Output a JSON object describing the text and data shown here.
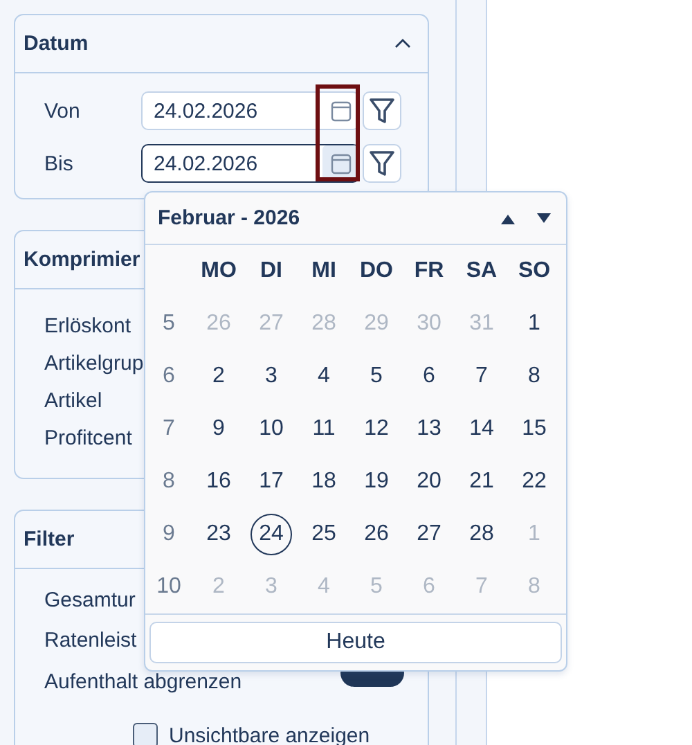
{
  "date_panel": {
    "title": "Datum",
    "expanded": true,
    "rows": [
      {
        "label": "Von",
        "value": "24.02.2026",
        "focused": false
      },
      {
        "label": "Bis",
        "value": "24.02.2026",
        "focused": true
      }
    ]
  },
  "compress_panel": {
    "title": "Komprimier",
    "items": [
      "Erlöskont",
      "Artikelgrup",
      "Artikel",
      "Profitcent"
    ]
  },
  "filter_panel": {
    "title": "Filter",
    "items": [
      {
        "kind": "text",
        "label": "Gesamtur"
      },
      {
        "kind": "toggle",
        "label": "Ratenleist",
        "label_line2": "Aufenthalt abgrenzen",
        "on": true
      }
    ],
    "checkbox": {
      "label": "Unsichtbare anzeigen",
      "checked": false
    }
  },
  "calendar": {
    "title": "Februar - 2026",
    "weekdays": [
      "MO",
      "DI",
      "MI",
      "DO",
      "FR",
      "SA",
      "SO"
    ],
    "weeks": [
      {
        "week": "5",
        "days": [
          {
            "day": "26",
            "outside": true,
            "selected": false
          },
          {
            "day": "27",
            "outside": true,
            "selected": false
          },
          {
            "day": "28",
            "outside": true,
            "selected": false
          },
          {
            "day": "29",
            "outside": true,
            "selected": false
          },
          {
            "day": "30",
            "outside": true,
            "selected": false
          },
          {
            "day": "31",
            "outside": true,
            "selected": false
          },
          {
            "day": "1",
            "outside": false,
            "selected": false
          }
        ]
      },
      {
        "week": "6",
        "days": [
          {
            "day": "2",
            "outside": false,
            "selected": false
          },
          {
            "day": "3",
            "outside": false,
            "selected": false
          },
          {
            "day": "4",
            "outside": false,
            "selected": false
          },
          {
            "day": "5",
            "outside": false,
            "selected": false
          },
          {
            "day": "6",
            "outside": false,
            "selected": false
          },
          {
            "day": "7",
            "outside": false,
            "selected": false
          },
          {
            "day": "8",
            "outside": false,
            "selected": false
          }
        ]
      },
      {
        "week": "7",
        "days": [
          {
            "day": "9",
            "outside": false,
            "selected": false
          },
          {
            "day": "10",
            "outside": false,
            "selected": false
          },
          {
            "day": "11",
            "outside": false,
            "selected": false
          },
          {
            "day": "12",
            "outside": false,
            "selected": false
          },
          {
            "day": "13",
            "outside": false,
            "selected": false
          },
          {
            "day": "14",
            "outside": false,
            "selected": false
          },
          {
            "day": "15",
            "outside": false,
            "selected": false
          }
        ]
      },
      {
        "week": "8",
        "days": [
          {
            "day": "16",
            "outside": false,
            "selected": false
          },
          {
            "day": "17",
            "outside": false,
            "selected": false
          },
          {
            "day": "18",
            "outside": false,
            "selected": false
          },
          {
            "day": "19",
            "outside": false,
            "selected": false
          },
          {
            "day": "20",
            "outside": false,
            "selected": false
          },
          {
            "day": "21",
            "outside": false,
            "selected": false
          },
          {
            "day": "22",
            "outside": false,
            "selected": false
          }
        ]
      },
      {
        "week": "9",
        "days": [
          {
            "day": "23",
            "outside": false,
            "selected": false
          },
          {
            "day": "24",
            "outside": false,
            "selected": true
          },
          {
            "day": "25",
            "outside": false,
            "selected": false
          },
          {
            "day": "26",
            "outside": false,
            "selected": false
          },
          {
            "day": "27",
            "outside": false,
            "selected": false
          },
          {
            "day": "28",
            "outside": false,
            "selected": false
          },
          {
            "day": "1",
            "outside": true,
            "selected": false
          }
        ]
      },
      {
        "week": "10",
        "days": [
          {
            "day": "2",
            "outside": true,
            "selected": false
          },
          {
            "day": "3",
            "outside": true,
            "selected": false
          },
          {
            "day": "4",
            "outside": true,
            "selected": false
          },
          {
            "day": "5",
            "outside": true,
            "selected": false
          },
          {
            "day": "6",
            "outside": true,
            "selected": false
          },
          {
            "day": "7",
            "outside": true,
            "selected": false
          },
          {
            "day": "8",
            "outside": true,
            "selected": false
          }
        ]
      }
    ],
    "today_button": "Heute"
  }
}
